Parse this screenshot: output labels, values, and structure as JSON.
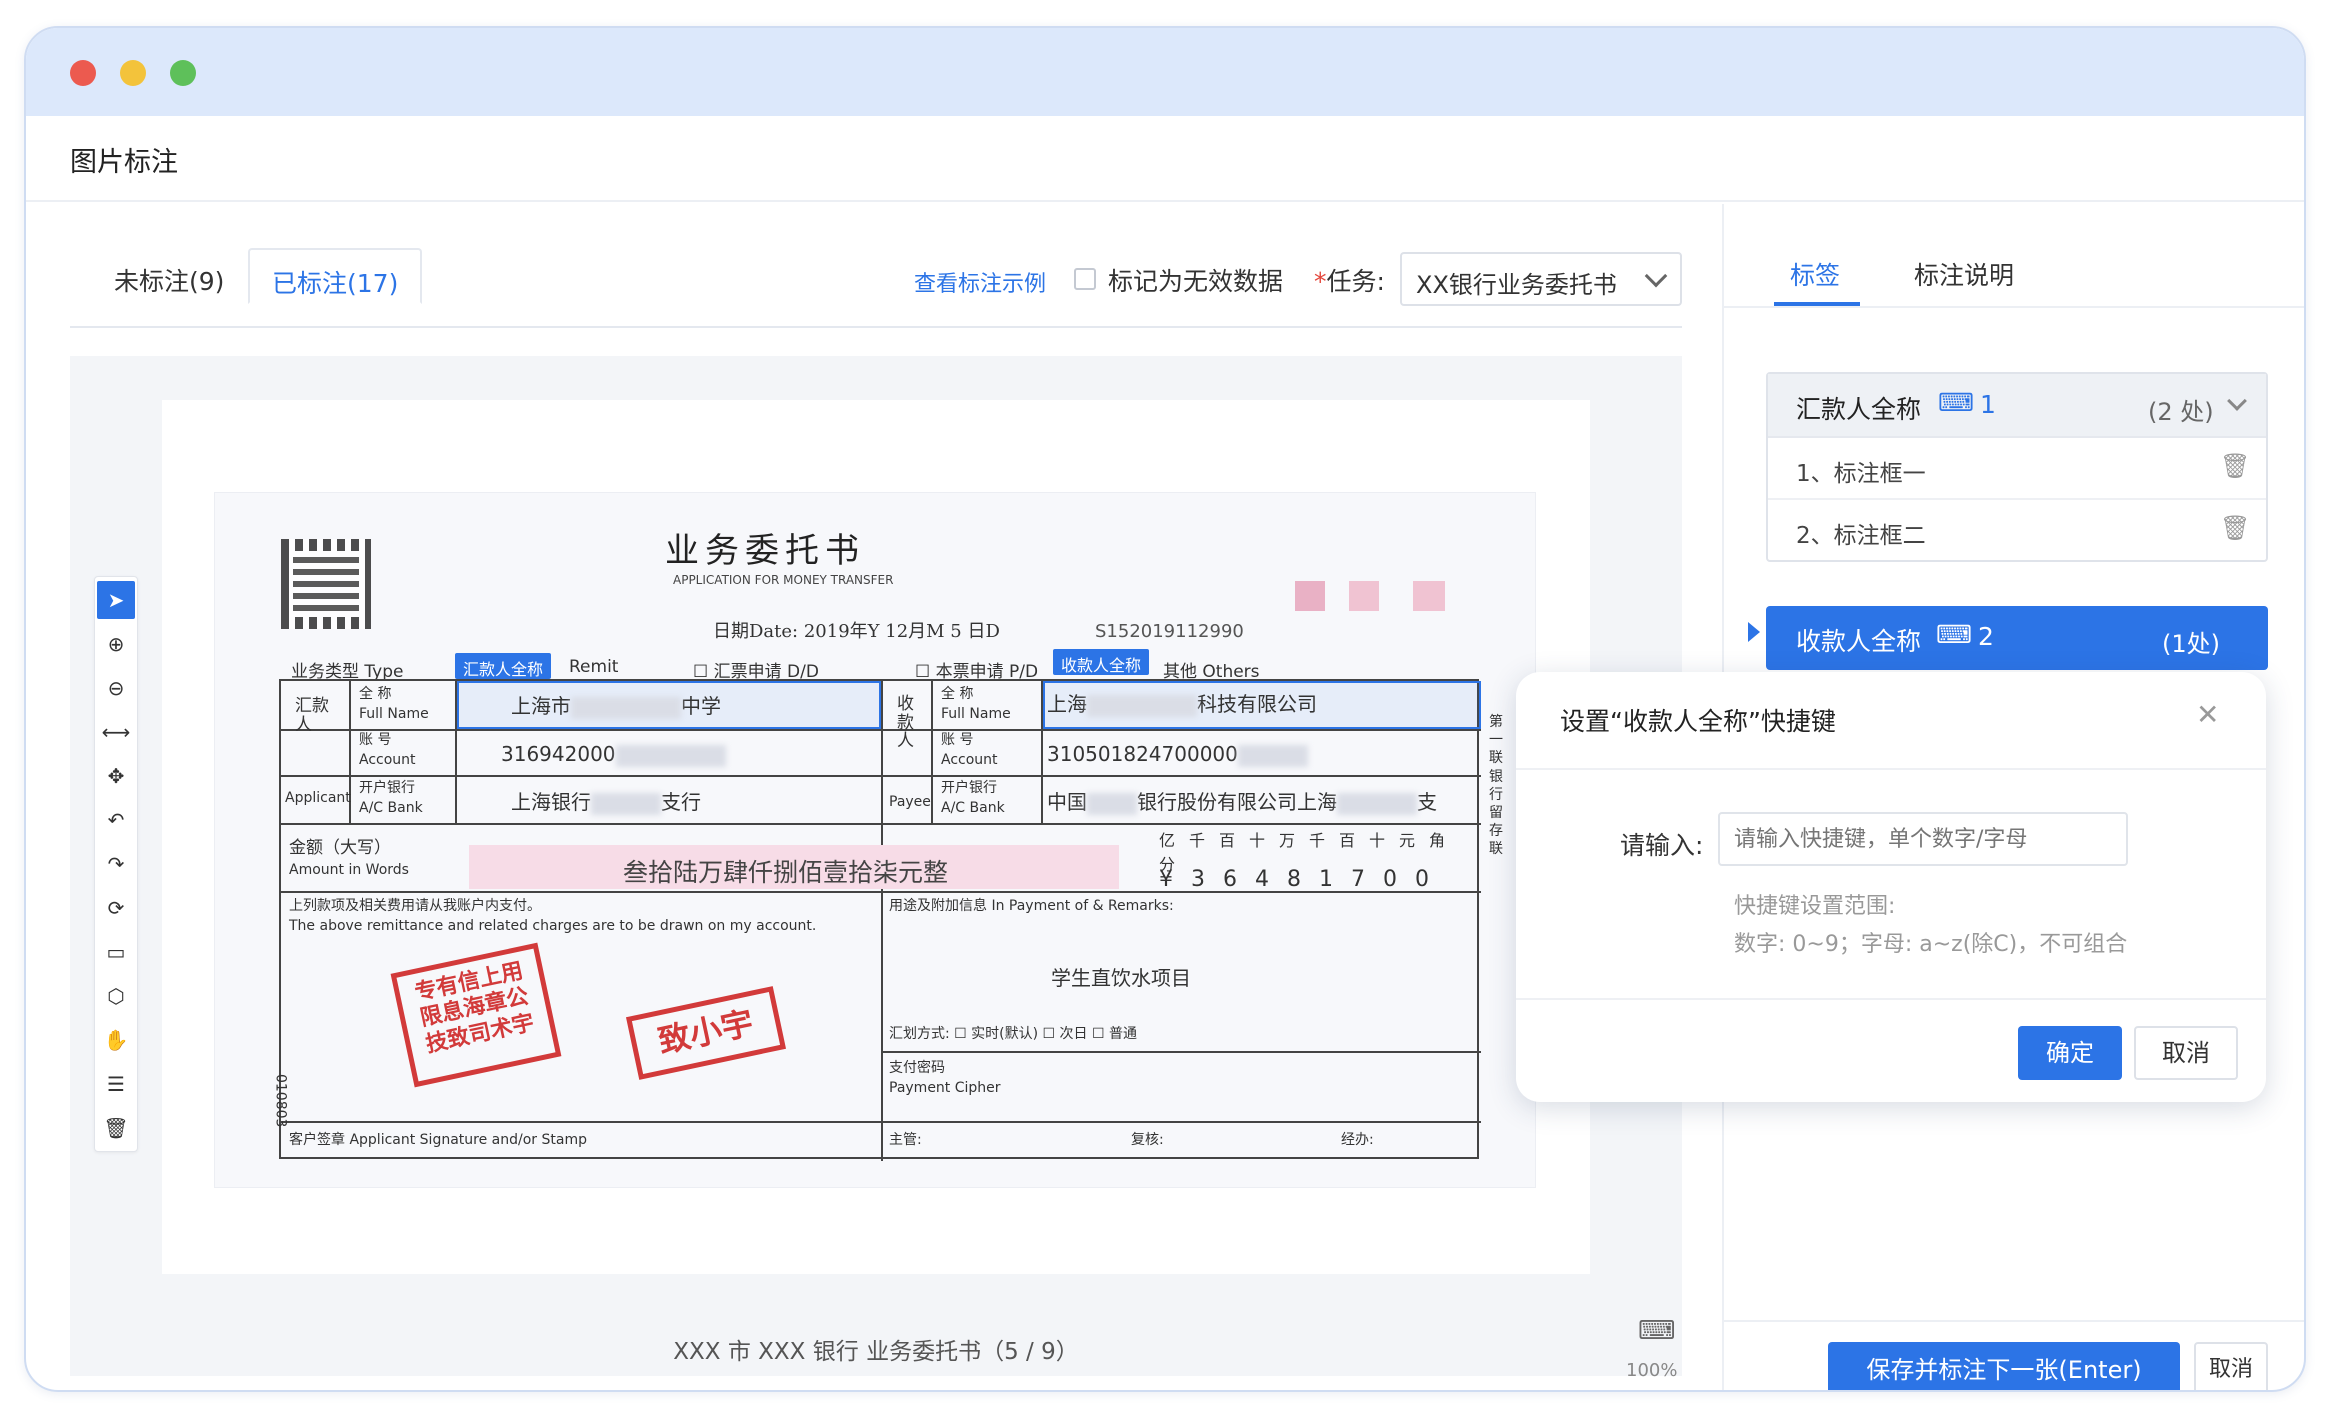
{
  "page": {
    "title": "图片标注"
  },
  "tabs": [
    {
      "label": "未标注(9)"
    },
    {
      "label": "已标注(17)"
    }
  ],
  "toolbar": {
    "example_link": "查看标注示例",
    "invalid_label": "标记为无效数据",
    "task_label": "任务:",
    "task_required": "*",
    "task_value": "XX银行业务委托书"
  },
  "tools": [
    {
      "icon": "select-arrow-icon",
      "glyph": "➤"
    },
    {
      "icon": "zoom-in-icon",
      "glyph": "⊕"
    },
    {
      "icon": "zoom-out-icon",
      "glyph": "⊖"
    },
    {
      "icon": "fit-width-icon",
      "glyph": "⟷"
    },
    {
      "icon": "move-icon",
      "glyph": "✥"
    },
    {
      "icon": "rotate-left-icon",
      "glyph": "↶"
    },
    {
      "icon": "rotate-right-icon",
      "glyph": "↷"
    },
    {
      "icon": "refresh-icon",
      "glyph": "⟳"
    },
    {
      "icon": "rectangle-icon",
      "glyph": "▭"
    },
    {
      "icon": "polygon-icon",
      "glyph": "⬡"
    },
    {
      "icon": "hand-icon",
      "glyph": "✋"
    },
    {
      "icon": "list-icon",
      "glyph": "☰"
    },
    {
      "icon": "delete-icon",
      "glyph": "🗑"
    }
  ],
  "document": {
    "title": "业务委托书",
    "subtitle": "APPLICATION FOR MONEY TRANSFER",
    "date_text": "日期Date: 2019年Y 12月M 5 日D",
    "serial": "S152019112990",
    "business_type": "业务类型 Type",
    "remit": "Remit",
    "dd": "☐ 汇票申请 D/D",
    "pd": "☐ 本票申请 P/D",
    "others": "其他 Others",
    "remitter_block": "汇款人",
    "applicant": "Applicant",
    "payee_block": "收款人",
    "payee_en": "Payee",
    "full_name_cn": "全 称",
    "full_name_en": "Full Name",
    "account_cn": "账 号",
    "account_en": "Account",
    "bank_cn": "开户银行",
    "bank_en": "A/C Bank",
    "remitter_name": "上海市",
    "remitter_name_suffix": "中学",
    "remitter_account": "316942000",
    "remitter_bank": "上海银行",
    "remitter_bank_suffix": "支行",
    "payee_name": "上海",
    "payee_name_suffix": "科技有限公司",
    "payee_account": "310501824700000",
    "payee_bank": "中国",
    "payee_bank_mid": "银行股份有限公司上海",
    "payee_bank_suffix": "支",
    "amount_label_cn": "金额（大写）",
    "amount_label_en": "Amount in Words",
    "amount_words": "叁拾陆万肆仟捌佰壹拾柒元整",
    "units": "亿千百十万千百十元角分",
    "digits": "¥36481700",
    "statement_cn": "上列款项及相关费用请从我账户内支付。",
    "statement_en": "The above remittance and related charges are to be drawn on my account.",
    "remarks_label": "用途及附加信息 In Payment of & Remarks:",
    "remarks_value": "学生直饮水项目",
    "method": "汇划方式: ☐ 实时(默认)  ☐ 次日  ☐ 普通",
    "cipher_cn": "支付密码",
    "cipher_en": "Payment Cipher",
    "signature": "客户签章 Applicant Signature and/or Stamp",
    "supervisor": "主管:",
    "checker": "复核:",
    "handler": "经办:",
    "side_text": "第一联 银行留存联",
    "serial_vertical": "010803",
    "stamp1": "专有信上用限息海章公技致司术宇",
    "stamp2": "致小宇",
    "tag_remitter": "汇款人全称",
    "tag_payee": "收款人全称"
  },
  "canvas": {
    "caption": "XXX 市 XXX 银行 业务委托书（5 / 9）",
    "zoom": "100%"
  },
  "right_tabs": [
    {
      "label": "标签"
    },
    {
      "label": "标注说明"
    }
  ],
  "label_groups": [
    {
      "name": "汇款人全称",
      "key": "1",
      "count": "(2 处)",
      "items": [
        {
          "label": "1、标注框一"
        },
        {
          "label": "2、标注框二"
        }
      ]
    },
    {
      "name": "收款人全称",
      "key": "2",
      "count": "(1处)"
    }
  ],
  "dialog": {
    "title": "设置“收款人全称”快捷键",
    "input_label": "请输入:",
    "input_placeholder": "请输入快捷键，单个数字/字母",
    "hint_title": "快捷键设置范围:",
    "hint_body": "数字: 0~9；字母: a~z(除C)，不可组合",
    "ok": "确定",
    "cancel": "取消"
  },
  "footer": {
    "save": "保存并标注下一张(Enter)",
    "cancel": "取消"
  },
  "colors": {
    "accent": "#2c74e6",
    "stamp": "#d23a3a",
    "titlebar": "#dce8fb"
  }
}
